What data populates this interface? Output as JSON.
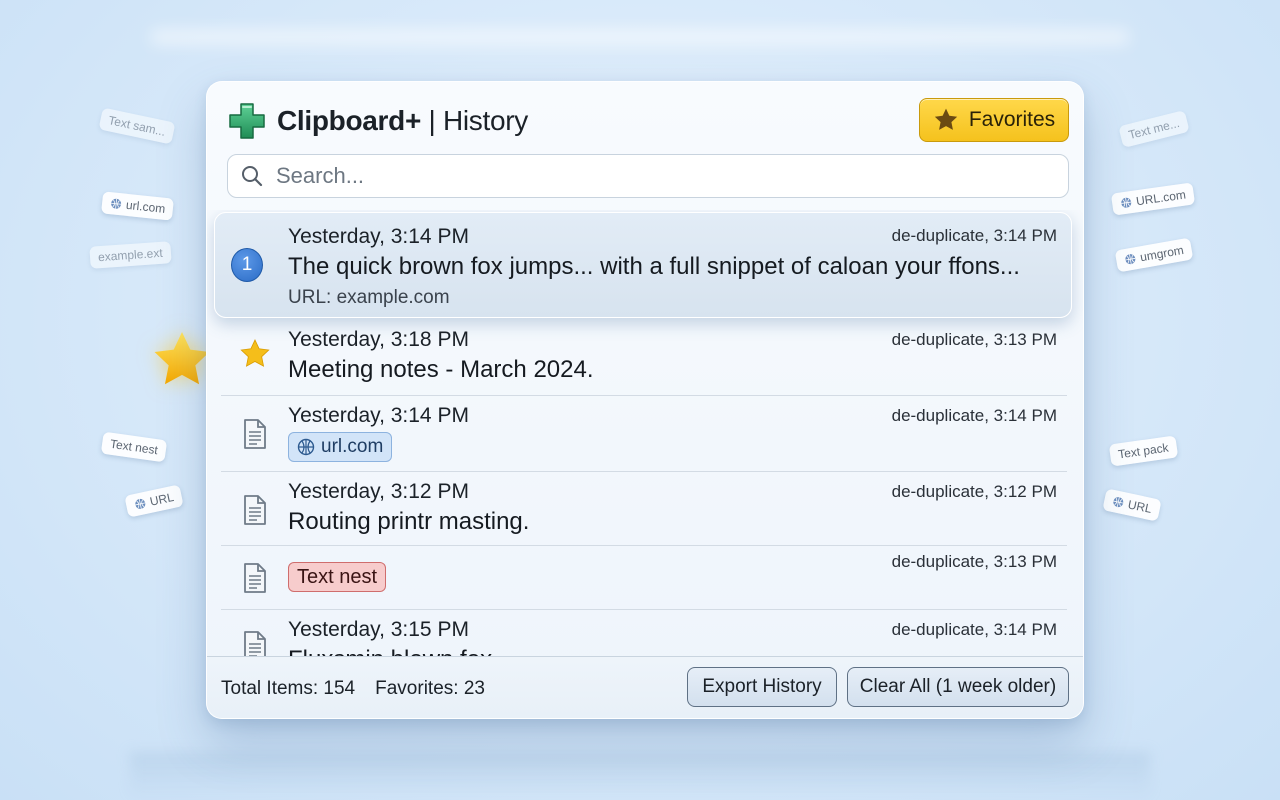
{
  "app": {
    "name": "Clipboard+",
    "separator": " | ",
    "section": "History"
  },
  "header": {
    "favorites_label": "Favorites"
  },
  "search": {
    "placeholder": "Search..."
  },
  "entries": [
    {
      "time": "Yesterday, 3:14 PM",
      "meta": "de-duplicate, 3:14 PM",
      "text": "The quick brown fox jumps... with a full snippet of caloan your ffons...",
      "url": "URL: example.com",
      "badge": "1",
      "selected": true,
      "icon": "number-badge"
    },
    {
      "time": "Yesterday, 3:18 PM",
      "meta": "de-duplicate, 3:13 PM",
      "text": "Meeting notes - March 2024.",
      "icon": "star-icon",
      "favorite": true
    },
    {
      "time": "Yesterday, 3:14 PM",
      "meta": "de-duplicate, 3:14 PM",
      "tag": "url.com",
      "tag_type": "url",
      "icon": "document-icon"
    },
    {
      "time": "Yesterday, 3:12 PM",
      "meta": "de-duplicate, 3:12 PM",
      "text": "Routing printr masting.",
      "icon": "document-icon"
    },
    {
      "time": "",
      "meta": "de-duplicate, 3:13 PM",
      "tag": "Text nest",
      "tag_type": "text",
      "icon": "document-icon"
    },
    {
      "time": "Yesterday, 3:15 PM",
      "meta": "de-duplicate, 3:14 PM",
      "text": "Fluxsmin blown fox...",
      "icon": "document-icon"
    }
  ],
  "footer": {
    "total_label": "Total Items: 154",
    "favorites_label": "Favorites: 23",
    "export_button": "Export History",
    "clear_button": "Clear All (1 week older)"
  },
  "floating_chips": {
    "left": [
      "Text sam...",
      "url.com",
      "example.ext",
      "Text nest",
      "URL"
    ],
    "right": [
      "Text me...",
      "URL.com",
      "umgrom",
      "Text pack",
      "URL"
    ]
  },
  "colors": {
    "accent_green": "#2fa86a",
    "favorites_yellow": "#f5c21d",
    "selected_badge_blue": "#2b6cc6",
    "tag_red": "#f7cccc",
    "tag_blue": "#d2e4f8"
  }
}
